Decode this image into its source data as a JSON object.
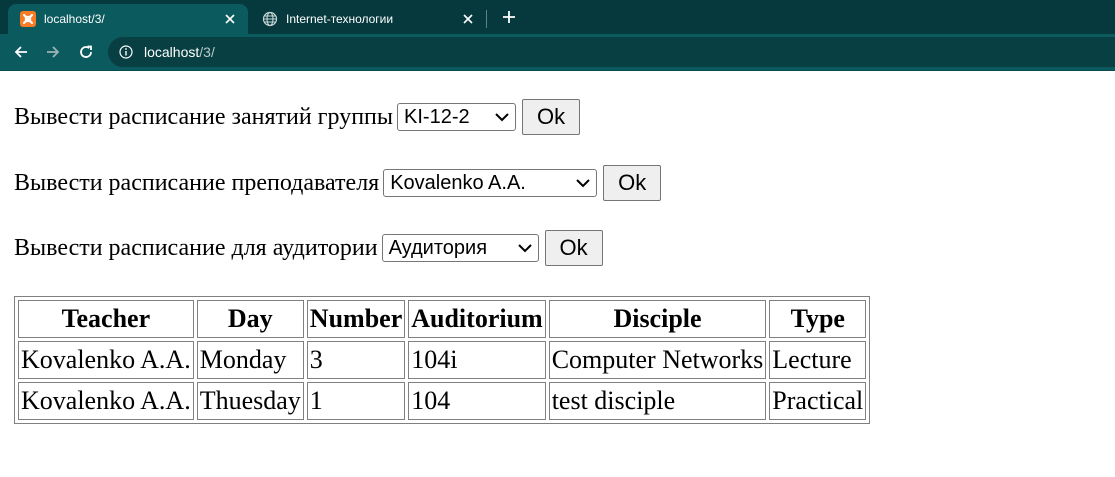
{
  "browser": {
    "tabs": [
      {
        "title": "localhost/3/",
        "active": true,
        "icon": "xampp-icon"
      },
      {
        "title": "Internet-технологии",
        "active": false,
        "icon": "globe-icon"
      }
    ],
    "url": {
      "host": "localhost",
      "path": "/3/"
    }
  },
  "forms": {
    "group": {
      "label": "Вывести расписание занятий группы",
      "selected": "KI-12-2",
      "button": "Ok"
    },
    "teacher": {
      "label": "Вывести расписание преподавателя",
      "selected": "Kovalenko A.A.",
      "button": "Ok"
    },
    "room": {
      "label": "Вывести расписание для аудитории",
      "selected": "Аудитория",
      "button": "Ok"
    }
  },
  "table": {
    "headers": [
      "Teacher",
      "Day",
      "Number",
      "Auditorium",
      "Disciple",
      "Type"
    ],
    "rows": [
      [
        "Kovalenko A.A.",
        "Monday",
        "3",
        "104i",
        "Computer Networks",
        "Lecture"
      ],
      [
        "Kovalenko A.A.",
        "Thuesday",
        "1",
        "104",
        "test disciple",
        "Practical"
      ]
    ]
  },
  "colors": {
    "tabbar": "#05393d",
    "toolbar": "#0b5a5e",
    "xampp_orange": "#fb7a24"
  }
}
